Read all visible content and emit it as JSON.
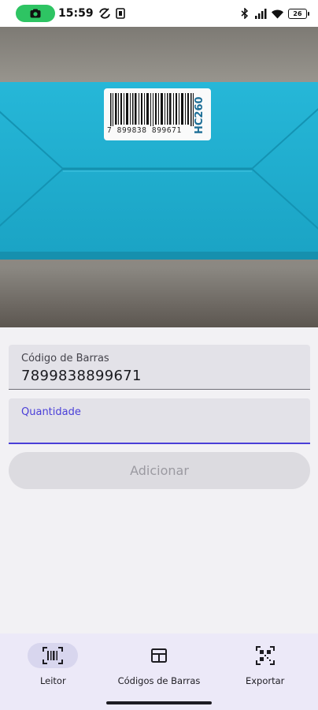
{
  "status_bar": {
    "time": "15:59",
    "battery": "26",
    "icons": [
      "camera-icon",
      "cloud-sync-icon",
      "notification-icon",
      "bluetooth-icon",
      "signal-icon",
      "wifi-icon",
      "battery-icon"
    ]
  },
  "camera": {
    "barcode_number": "7 899838 899671",
    "label_side_text": "HC260",
    "colors": {
      "box": "#1faecf",
      "box_dark": "#1592b2",
      "label": "#fafafa"
    }
  },
  "form": {
    "barcode_field": {
      "label": "Código de Barras",
      "value": "7899838899671"
    },
    "quantity_field": {
      "label": "Quantidade",
      "value": ""
    },
    "add_button_label": "Adicionar"
  },
  "bottom_nav": {
    "items": [
      {
        "label": "Leitor",
        "icon": "barcode-scanner-icon",
        "active": true
      },
      {
        "label": "Códigos de Barras",
        "icon": "table-icon",
        "active": false
      },
      {
        "label": "Exportar",
        "icon": "qr-code-icon",
        "active": false
      }
    ]
  },
  "colors": {
    "accent": "#4a3fd8",
    "nav_background": "#ece9f8",
    "nav_active_pill": "#d8d6ee",
    "record_pill": "#2ec463"
  }
}
